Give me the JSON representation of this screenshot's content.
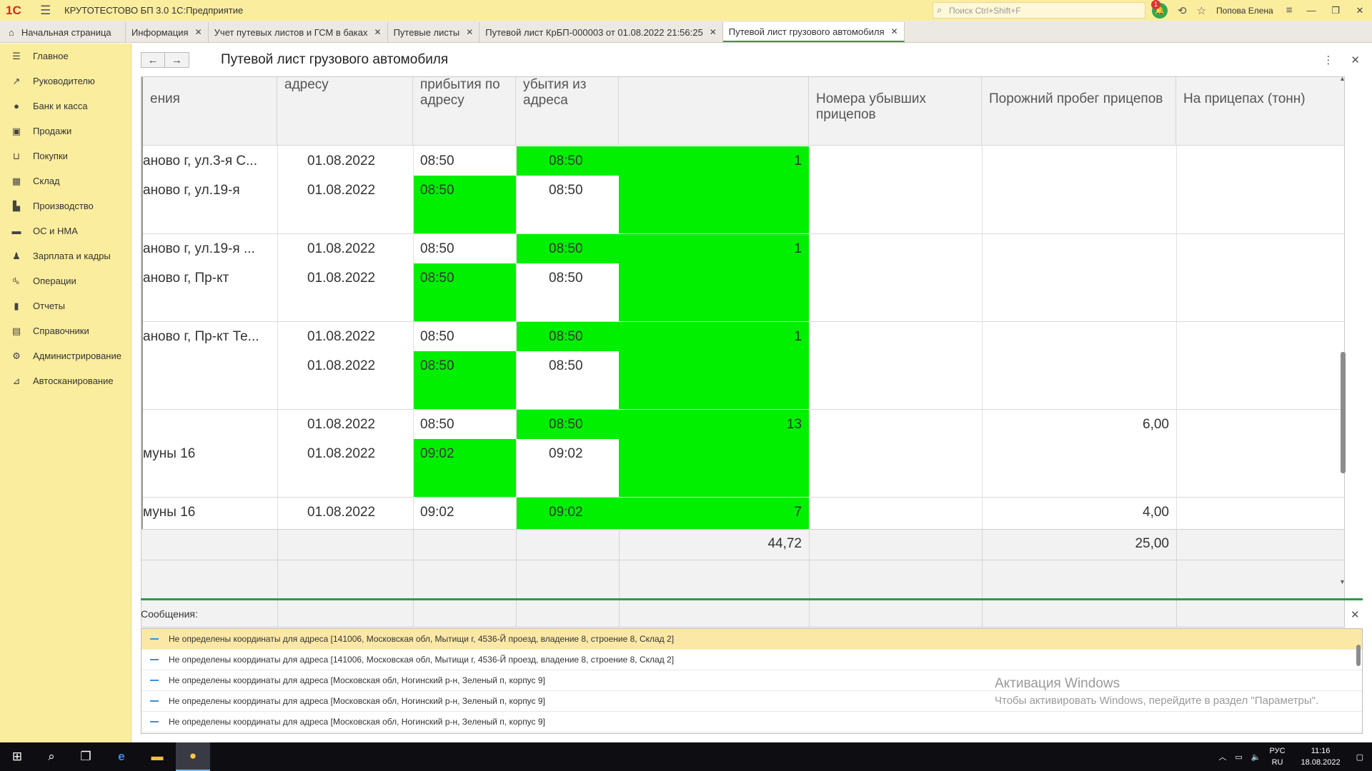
{
  "titlebar": {
    "app_title": "КРУТОТЕСТОВО БП 3.0 1С:Предприятие",
    "search_placeholder": "Поиск Ctrl+Shift+F",
    "notifications_count": "1",
    "user": "Попова Елена"
  },
  "tabs": [
    {
      "label": "Начальная страница"
    },
    {
      "label": "Информация"
    },
    {
      "label": "Учет путевых листов и ГСМ в баках"
    },
    {
      "label": "Путевые листы"
    },
    {
      "label": "Путевой лист КрБП-000003 от 01.08.2022 21:56:25"
    },
    {
      "label": "Путевой лист грузового автомобиля"
    }
  ],
  "sidebar": {
    "items": [
      {
        "label": "Главное",
        "icon": "menu-icon"
      },
      {
        "label": "Руководителю",
        "icon": "trend-icon"
      },
      {
        "label": "Банк и касса",
        "icon": "bank-icon"
      },
      {
        "label": "Продажи",
        "icon": "bag-icon"
      },
      {
        "label": "Покупки",
        "icon": "cart-icon"
      },
      {
        "label": "Склад",
        "icon": "warehouse-icon"
      },
      {
        "label": "Производство",
        "icon": "factory-icon"
      },
      {
        "label": "ОС и НМА",
        "icon": "truck-icon"
      },
      {
        "label": "Зарплата и кадры",
        "icon": "person-icon"
      },
      {
        "label": "Операции",
        "icon": "operations-icon"
      },
      {
        "label": "Отчеты",
        "icon": "bar-chart-icon"
      },
      {
        "label": "Справочники",
        "icon": "book-icon"
      },
      {
        "label": "Администрирование",
        "icon": "gear-icon"
      },
      {
        "label": "Автосканирование",
        "icon": "scan-icon"
      }
    ]
  },
  "form": {
    "title": "Путевой лист грузового автомобиля"
  },
  "grid": {
    "headers": {
      "col_name": "ения",
      "col_date": "адресу",
      "col_arrival": [
        "прибытия по",
        "адресу"
      ],
      "col_departure": [
        "убытия из",
        "адреса"
      ],
      "col_trailers": [
        "Номера убывших",
        "прицепов"
      ],
      "col_empty_mileage": "Порожний пробег прицепов",
      "col_tons": "На прицепах (тонн)"
    },
    "groups": [
      {
        "row1": {
          "name": "аново г, ул.3-я С...",
          "date": "01.08.2022",
          "arrival": "08:50",
          "departure": "08:50",
          "value": "1",
          "mileage": ""
        },
        "row2": {
          "name": "аново г, ул.19-я",
          "date": "01.08.2022",
          "arrival": "08:50",
          "departure": "08:50"
        }
      },
      {
        "row1": {
          "name": "аново г, ул.19-я ...",
          "date": "01.08.2022",
          "arrival": "08:50",
          "departure": "08:50",
          "value": "1",
          "mileage": ""
        },
        "row2": {
          "name": "аново г, Пр-кт",
          "date": "01.08.2022",
          "arrival": "08:50",
          "departure": "08:50"
        }
      },
      {
        "row1": {
          "name": "аново г, Пр-кт Те...",
          "date": "01.08.2022",
          "arrival": "08:50",
          "departure": "08:50",
          "value": "1",
          "mileage": ""
        },
        "row2": {
          "name": "",
          "date": "01.08.2022",
          "arrival": "08:50",
          "departure": "08:50"
        }
      },
      {
        "row1": {
          "name": "",
          "date": "01.08.2022",
          "arrival": "08:50",
          "departure": "08:50",
          "value": "13",
          "mileage": "6,00"
        },
        "row2": {
          "name": "муны 16",
          "date": "01.08.2022",
          "arrival": "09:02",
          "departure": "09:02"
        }
      },
      {
        "row1": {
          "name": "муны 16",
          "date": "01.08.2022",
          "arrival": "09:02",
          "departure": "09:02",
          "value": "7",
          "mileage": "4,00"
        }
      }
    ],
    "totals": {
      "value": "44,72",
      "mileage": "25,00"
    }
  },
  "messages": {
    "title": "Сообщения:",
    "items": [
      "Не определены координаты для адреса [141006, Московская обл, Мытищи г, 4536-Й проезд, владение 8, строение 8,  Склад 2]",
      "Не определены координаты для адреса [141006, Московская обл, Мытищи г, 4536-Й проезд, владение 8, строение 8,  Склад 2]",
      "Не определены координаты для адреса [Московская обл, Ногинский р-н, Зеленый п, корпус 9]",
      "Не определены координаты для адреса [Московская обл, Ногинский р-н, Зеленый п, корпус 9]",
      "Не определены координаты для адреса [Московская обл, Ногинский р-н, Зеленый п, корпус 9]"
    ]
  },
  "activation": {
    "title": "Активация Windows",
    "text": "Чтобы активировать Windows, перейдите в раздел \"Параметры\"."
  },
  "taskbar": {
    "lang": "РУС",
    "lang2": "RU",
    "time": "11:16",
    "date": "18.08.2022"
  },
  "colors": {
    "highlight_green": "#00f000",
    "sidebar_bg": "#fbed9e",
    "accent_green": "#2d9b4a"
  }
}
